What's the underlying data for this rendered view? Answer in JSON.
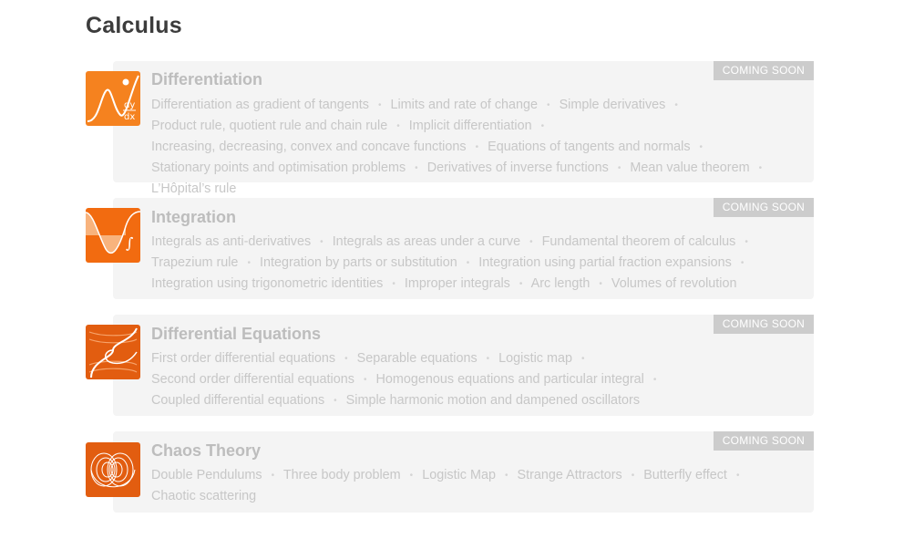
{
  "page": {
    "title": "Calculus"
  },
  "colors": {
    "accent": "#f26b10",
    "card_bg": "#f4f4f4",
    "badge_bg": "#cccccc",
    "muted_text": "#c7c7c7"
  },
  "courses": [
    {
      "title": "Differentiation",
      "badge": "COMING SOON",
      "icon": "derivative-dy-dx-icon",
      "topics": [
        "Differentiation as gradient of tangents",
        "Limits and rate of change",
        "Simple derivatives",
        "Product rule, quotient rule and chain rule",
        "Implicit differentiation",
        "Increasing, decreasing, convex and concave functions",
        "Equations of tangents and normals",
        "Stationary points and optimisation problems",
        "Derivatives of inverse functions",
        "Mean value theorem",
        "L’Hôpital’s rule"
      ]
    },
    {
      "title": "Integration",
      "badge": "COMING SOON",
      "icon": "integral-curve-icon",
      "topics": [
        "Integrals as anti-derivatives",
        "Integrals as areas under a curve",
        "Fundamental theorem of calculus",
        "Trapezium rule",
        "Integration by parts or substitution",
        "Integration using partial fraction expansions",
        "Integration using trigonometric identities",
        "Improper integrals",
        "Arc length",
        "Volumes of revolution"
      ]
    },
    {
      "title": "Differential Equations",
      "badge": "COMING SOON",
      "icon": "slope-field-icon",
      "topics": [
        "First order differential equations",
        "Separable equations",
        "Logistic map",
        "Second order differential equations",
        "Homogenous equations and particular integral",
        "Coupled differential equations",
        "Simple harmonic motion and dampened oscillators"
      ]
    },
    {
      "title": "Chaos Theory",
      "badge": "COMING SOON",
      "icon": "strange-attractor-icon",
      "topics": [
        "Double Pendulums",
        "Three body problem",
        "Logistic Map",
        "Strange Attractors",
        "Butterfly effect",
        "Chaotic scattering"
      ]
    }
  ]
}
